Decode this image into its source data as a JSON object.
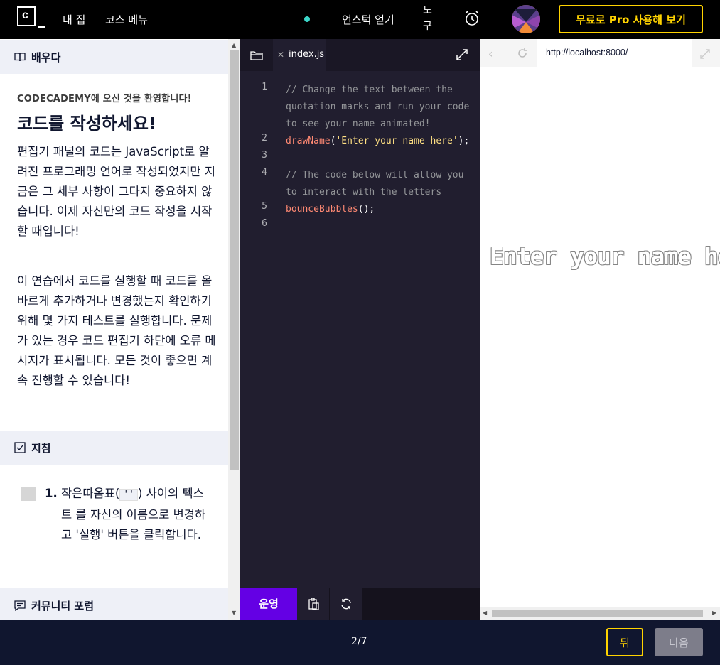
{
  "topbar": {
    "logo_glyph": "c",
    "nav": {
      "my_home": "내 집",
      "course_menu": "코스 메뉴"
    },
    "get_unstuck": "언스턱 얻기",
    "tools": "도구",
    "pro_button": "무료로 Pro 사용해 보기",
    "accent_color": "#ffd300",
    "status_dot_color": "#3cd6c9"
  },
  "learn_panel": {
    "header": "배우다",
    "welcome": "CODECADEMY에 오신 것을 환영합니다!",
    "title": "코드를 작성하세요!",
    "paragraph1": "편집기 패널의 코드는 JavaScript로 알려진 프로그래밍 언어로 작성되었지만 지금은 그 세부 사항이 그다지 중요하지 않습니다. 이제 자신만의 코드 작성을 시작할 때입니다!",
    "paragraph2": "이 연습에서 코드를 실행할 때 코드를 올바르게 추가하거나 변경했는지 확인하기 위해 몇 가지 테스트를 실행합니다. 문제가 있는 경우 코드 편집기 하단에 오류 메시지가 표시됩니다. 모든 것이 좋으면 계속 진행할 수 있습니다!",
    "instructions_header": "지침",
    "task": {
      "number": "1.",
      "text_before": "작은따옴표(",
      "code": "''",
      "text_after": ") 사이의 텍스트 를 자신의 이름으로 변경하고 '실행' 버튼을 클릭합니다."
    },
    "forum_header": "커뮤니티 포럼"
  },
  "editor": {
    "file_tab": "index.js",
    "lines": [
      {
        "num": "1",
        "comment": "// Change the text between the quotation marks and run your code to see your name animated!"
      },
      {
        "num": "2",
        "fn": "drawName",
        "open": "(",
        "str": "'Enter your name here'",
        "close": ");"
      },
      {
        "num": "3"
      },
      {
        "num": "4",
        "comment": "// The code below will allow you to interact with the letters"
      },
      {
        "num": "5",
        "fn": "bounceBubbles",
        "close": "();"
      },
      {
        "num": "6"
      }
    ],
    "run_button": "운영",
    "run_color": "#6400e4"
  },
  "browser": {
    "url": "http://localhost:8000/",
    "preview_text": "Enter your name here"
  },
  "footer": {
    "progress": "2/7",
    "back": "뒤",
    "next": "다음"
  }
}
